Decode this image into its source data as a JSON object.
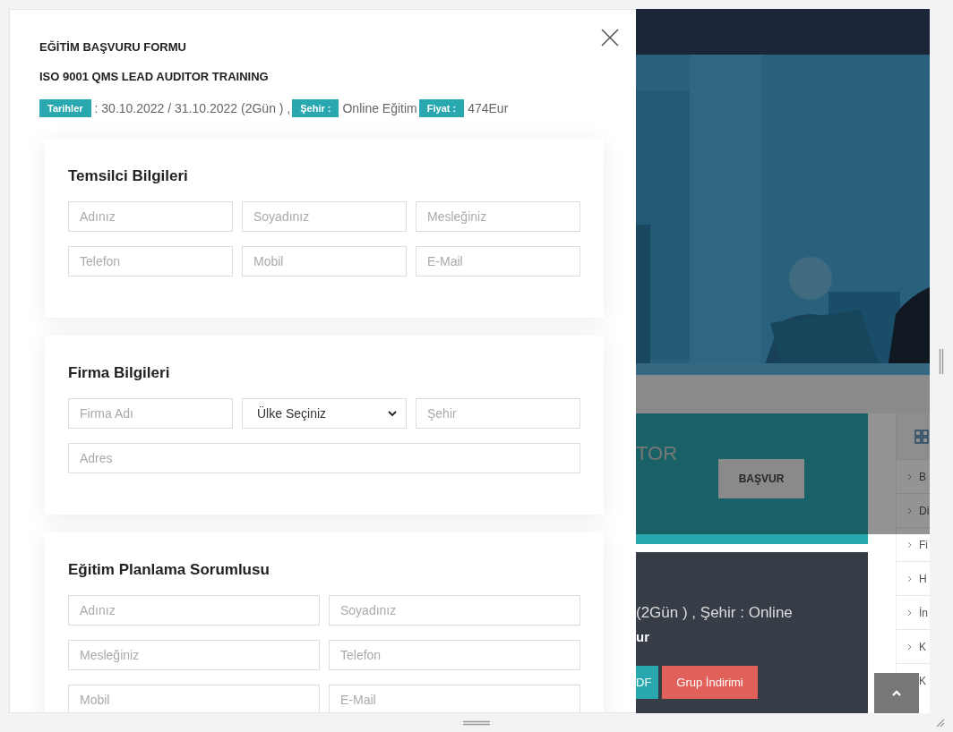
{
  "modal": {
    "title": "EĞİTİM BAŞVURU FORMU",
    "subtitle": "ISO 9001 QMS LEAD AUDITOR TRAINING",
    "info": [
      {
        "label": "Tarihler",
        "value": ": 30.10.2022 / 31.10.2022 (2Gün ) ,"
      },
      {
        "label": "Şehir :",
        "value": "Online Eğitim"
      },
      {
        "label": "Fiyat :",
        "value": "474Eur"
      }
    ],
    "sections": [
      {
        "title": "Temsilci Bilgileri",
        "kind": "three-column",
        "fields": [
          {
            "kind": "input",
            "placeholder": "Adınız"
          },
          {
            "kind": "input",
            "placeholder": "Soyadınız"
          },
          {
            "kind": "input",
            "placeholder": "Mesleğiniz"
          },
          {
            "kind": "input",
            "placeholder": "Telefon"
          },
          {
            "kind": "input",
            "placeholder": "Mobil"
          },
          {
            "kind": "input",
            "placeholder": "E-Mail"
          }
        ]
      },
      {
        "title": "Firma Bilgileri",
        "kind": "three-column",
        "fields": [
          {
            "kind": "input",
            "placeholder": "Firma Adı"
          },
          {
            "kind": "select",
            "value": "Ülke Seçiniz"
          },
          {
            "kind": "input",
            "placeholder": "Şehir"
          },
          {
            "kind": "wide",
            "placeholder": "Adres"
          }
        ]
      },
      {
        "title": "Eğitim Planlama Sorumlusu",
        "kind": "two-column",
        "fields": [
          {
            "kind": "input",
            "placeholder": "Adınız"
          },
          {
            "kind": "input",
            "placeholder": "Soyadınız"
          },
          {
            "kind": "input",
            "placeholder": "Mesleğiniz"
          },
          {
            "kind": "input",
            "placeholder": "Telefon"
          },
          {
            "kind": "input",
            "placeholder": "Mobil"
          },
          {
            "kind": "input",
            "placeholder": "E-Mail"
          }
        ]
      }
    ]
  },
  "background_page": {
    "heading": "TOR",
    "apply_button": "BAŞVUR",
    "info": "(2Gün ) , Şehir : Online",
    "price": "ur",
    "buttons": [
      {
        "label": "DF",
        "color": "#2aa8b0"
      },
      {
        "label": "Grup İndirimi",
        "color": "#e2605a"
      }
    ],
    "sidebar_items": [
      "B",
      "Di",
      "Fi",
      "H",
      "İn",
      "K",
      "K"
    ]
  }
}
